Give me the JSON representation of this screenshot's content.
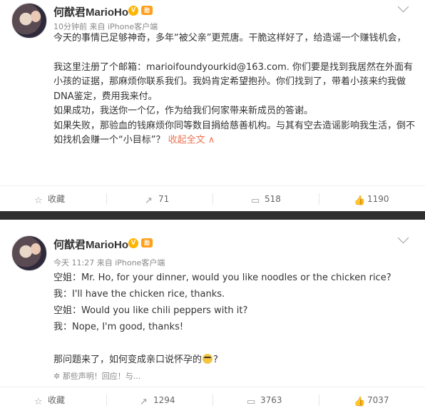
{
  "post1": {
    "username": "何猷君MarioHo",
    "verified": "V",
    "level": "勋",
    "timestamp": "10分钟前",
    "source": "来自 iPhone客户端",
    "lines": [
      "今天的事情已足够神奇，多年“被父亲”更荒唐。干脆这样好了，给造谣一个赚钱机会，",
      "",
      "我这里注册了个邮箱：marioifoundyourkid@163.com. 你们要是找到我居然在外面有小孩的证据，那麻烦你联系我们。我妈肯定希望抱孙。你们找到了，带着小孩来约我做DNA鉴定，费用我来付。",
      "如果成功，我送你一个亿，作为给我们何家带来新成员的答谢。",
      "如果失败，那验血的钱麻烦你同等数目捐给慈善机构。与其有空去造谣影响我生活，倒不如找机会赚一个“小目标”？"
    ],
    "collapse_label": "收起全文 ∧",
    "actions": {
      "favorite": "收藏",
      "repost": "71",
      "comment": "518",
      "like": "1190"
    }
  },
  "post2": {
    "username": "何猷君MarioHo",
    "verified": "V",
    "level": "勋",
    "timestamp": "今天 11:27",
    "source": "来自 iPhone客户端",
    "lines": [
      "空姐：Mr. Ho, for your dinner, would you like noodles or the chicken rice?",
      "我：I'll have the chicken rice, thanks.",
      "空姐：Would you like chili peppers with it?",
      "我：Nope, I'm good, thanks!",
      "",
      "那问题来了，如何变成亲口说怀孕的"
    ],
    "trailing": "?",
    "signature": "那些声明！回应！与...",
    "actions": {
      "favorite": "收藏",
      "repost": "1294",
      "comment": "3763",
      "like": "7037"
    }
  }
}
